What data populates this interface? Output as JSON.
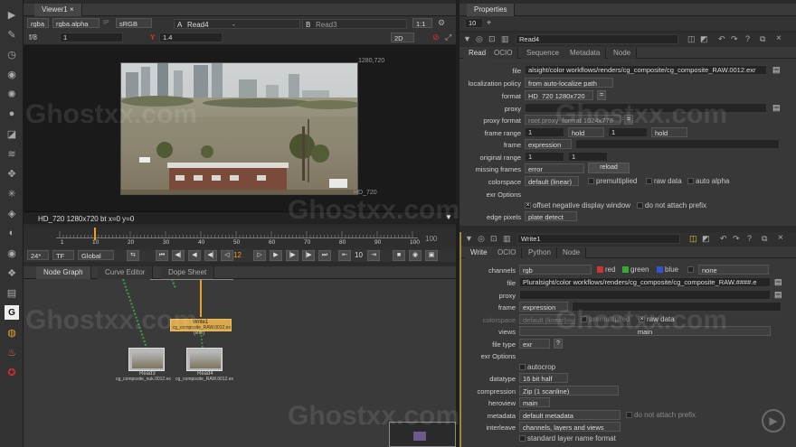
{
  "viewer": {
    "tab_title": "Viewer1",
    "channels": "rgba",
    "alpha": "rgba.alpha",
    "ip_label": "IP",
    "colorspace": "sRGB",
    "a_label": "A",
    "a_input": "Read4",
    "a_sep": "-",
    "b_label": "B",
    "b_input": "Read3",
    "zoom": "1:1",
    "fstop": "f/8",
    "frame_field": "1",
    "y_label": "Y",
    "gain": "1.4",
    "view_mode": "2D",
    "res_top": "1280,720",
    "res_bottom": "HD_720",
    "info_bar": "HD_720 1280x720  bt  x=0 y=0"
  },
  "timeline": {
    "ticks": [
      "1",
      "10",
      "20",
      "30",
      "40",
      "50",
      "60",
      "70",
      "80",
      "90",
      "100"
    ],
    "end": "100",
    "fps": "24*",
    "tf": "TF",
    "global": "Global",
    "current_frame": "12",
    "step": "10"
  },
  "graph_tabs": [
    {
      "label": "Node Graph",
      "active": true
    },
    {
      "label": "Curve Editor",
      "active": false
    },
    {
      "label": "Dope Sheet",
      "active": false
    }
  ],
  "nodes": {
    "write": {
      "label": "Write1",
      "sub": "cg_composite_RAW.0012.ex",
      "sub2": "(exr)"
    },
    "read3": {
      "label": "Read3",
      "sub": "cg_composite_nuk.0012.ex"
    },
    "read4": {
      "label": "Read4",
      "sub": "cg_composite_RAW.0012.ex"
    }
  },
  "properties": {
    "tab_title": "Properties",
    "count": "10",
    "read": {
      "name": "Read4",
      "tabs": [
        "Read",
        "OCIO",
        "Sequence",
        "Metadata",
        "Node"
      ],
      "file_label": "file",
      "file": "alsight/color workflows/renders/cg_composite/cg_composite_RAW.0012.exr",
      "localization_label": "localization policy",
      "localization": "from auto-localize path",
      "format_label": "format",
      "format": "HD_720 1280x720",
      "proxy_label": "proxy",
      "proxy_format_label": "proxy format",
      "proxy_format": "root.proxy_format 1024x778",
      "frame_range_label": "frame range",
      "frame_start": "1",
      "before": "hold",
      "frame_end": "1",
      "after": "hold",
      "frame_label": "frame",
      "frame_mode": "expression",
      "original_range_label": "original range",
      "orig_start": "1",
      "orig_end": "1",
      "missing_label": "missing frames",
      "missing": "error",
      "reload": "reload",
      "colorspace_label": "colorspace",
      "colorspace": "default (linear)",
      "premultiplied": "premultiplied",
      "raw_data": "raw data",
      "auto_alpha": "auto alpha",
      "exr_options": "exr Options",
      "offset_neg": "offset negative display window",
      "no_prefix": "do not attach prefix",
      "edge_label": "edge pixels",
      "edge": "plate detect"
    },
    "write": {
      "name": "Write1",
      "tabs": [
        "Write",
        "OCIO",
        "Python",
        "Node"
      ],
      "channels_label": "channels",
      "channels": "rgb",
      "red": "red",
      "green": "green",
      "blue": "blue",
      "extra": "none",
      "file_label": "file",
      "file": "Pluralsight/color workflows/renders/cg_composite/cg_composite_RAW.####.e",
      "proxy_label": "proxy",
      "frame_label": "frame",
      "frame": "expression",
      "colorspace_label": "colorspace",
      "colorspace": "default (linear)",
      "premultiplied": "premultiplied",
      "raw_data": "raw data",
      "views_label": "views",
      "views": "main",
      "filetype_label": "file type",
      "filetype": "exr",
      "help": "?",
      "exr_options": "exr Options",
      "autocrop": "autocrop",
      "datatype_label": "datatype",
      "datatype": "16 bit half",
      "compression_label": "compression",
      "compression": "Zip (1 scanline)",
      "heroview_label": "heroview",
      "heroview": "main",
      "metadata_label": "metadata",
      "metadata": "default metadata",
      "no_prefix": "do not attach prefix",
      "interleave_label": "interleave",
      "interleave": "channels, layers and views",
      "std_layer": "standard layer name format"
    }
  },
  "watermark": "Ghostxx.com",
  "colors": {
    "accent": "#f0a020",
    "write_node": "#d9a94a",
    "read_node": "#b8b8b8",
    "panel": "#383838"
  }
}
